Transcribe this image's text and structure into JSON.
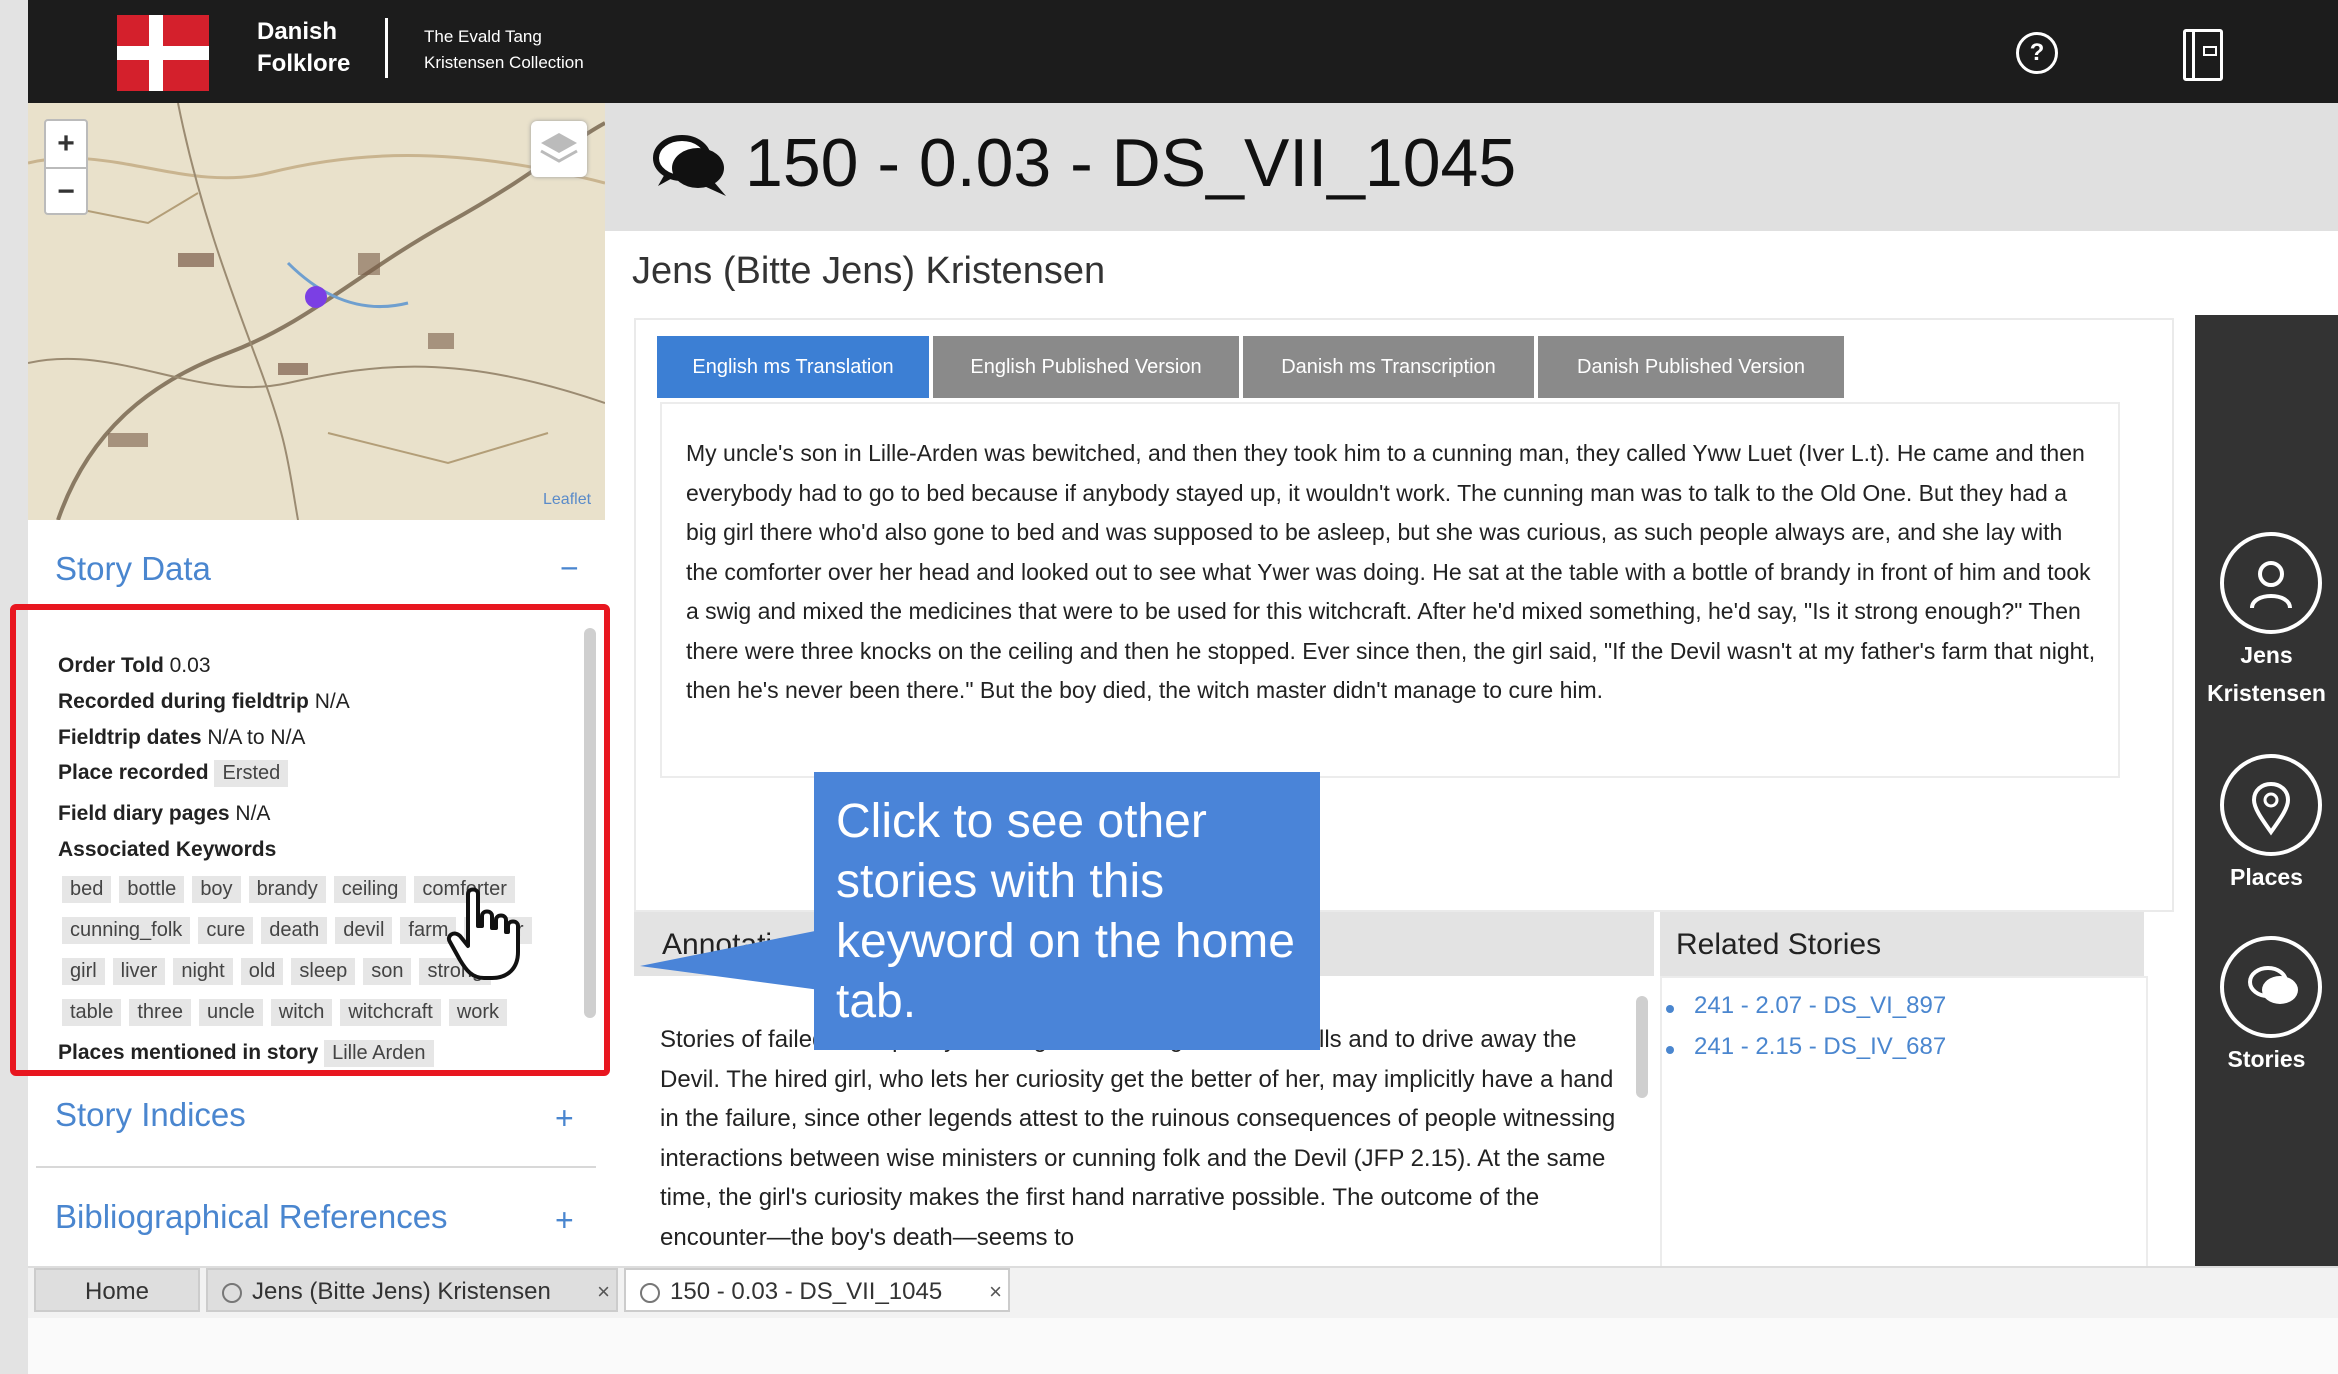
{
  "header": {
    "brand_line1": "Danish",
    "brand_line2": "Folklore",
    "subtitle_line1": "The Evald Tang",
    "subtitle_line2": "Kristensen Collection",
    "help_label": "?"
  },
  "map": {
    "zoom_in": "+",
    "zoom_out": "−",
    "attribution": "Leaflet",
    "marker_color": "#7b3fe4"
  },
  "story_data": {
    "title": "Story Data",
    "collapse_sign": "−",
    "order_told_label": "Order Told",
    "order_told_value": "0.03",
    "recorded_label": "Recorded during fieldtrip",
    "recorded_value": "N/A",
    "dates_label": "Fieldtrip dates",
    "dates_value": "N/A to N/A",
    "place_label": "Place recorded",
    "place_value": "Ersted",
    "diary_label": "Field diary pages",
    "diary_value": "N/A",
    "keywords_label": "Associated Keywords",
    "keywords_row1": [
      "bed",
      "bottle",
      "boy",
      "brandy",
      "ceiling",
      "comforter"
    ],
    "keywords_row2": [
      "cunning_folk",
      "cure",
      "death",
      "devil",
      "farm",
      "father"
    ],
    "keywords_row3": [
      "girl",
      "liver",
      "night",
      "old",
      "sleep",
      "son",
      "strong"
    ],
    "keywords_row4": [
      "table",
      "three",
      "uncle",
      "witch",
      "witchcraft",
      "work"
    ],
    "places_label": "Places mentioned in story",
    "places_value": "Lille Arden"
  },
  "story_indices": {
    "title": "Story Indices",
    "sign": "+"
  },
  "biblio": {
    "title": "Bibliographical References",
    "sign": "+"
  },
  "main": {
    "title": "150 - 0.03 - DS_VII_1045",
    "person": "Jens (Bitte Jens) Kristensen",
    "tabs": [
      "English ms Translation",
      "English Published Version",
      "Danish ms Transcription",
      "Danish Published Version"
    ],
    "story_text": "My uncle's son in Lille-Arden was bewitched, and then they took him to a cunning man, they called Yww Luet (Iver L.t). He came and then everybody had to go to bed because if anybody stayed up, it wouldn't work. The cunning man was to talk to the Old One. But they had a big girl there who'd also gone to bed and was supposed to be asleep, but she was curious, as such people always are, and she lay with the comforter over her head and looked out to see what Ywer was doing. He sat at the table with a bottle of brandy in front of him and took a swig and mixed the medicines that were to be used for this witchcraft. After he'd mixed something, he'd say, \"Is it strong enough?\" Then there were three knocks on the ceiling and then he stopped. Ever since then, the girl said, \"If the Devil wasn't at my father's farm that night, then he's never been there.\" But the boy died, the witch master didn't manage to cure him.",
    "annotation_header": "Annotation",
    "annotation_text": "Stories of failed attempts by cunning folk ... hiring folk to cure ills and to drive away the Devil. The hired girl, who lets her curiosity get the better of her, may implicitly have a hand in the failure, since other legends attest to the ruinous consequences of people witnessing interactions between wise ministers or cunning folk and the Devil (JFP 2.15). At the same time, the girl's curiosity makes the first hand narrative possible. The outcome of the encounter—the boy's death—seems to",
    "related_header": "Related Stories",
    "related": [
      "241 - 2.07 - DS_VI_897",
      "241 - 2.15 - DS_IV_687"
    ]
  },
  "right_panel": {
    "person_label_1": "Jens",
    "person_label_2": "Kristensen",
    "places_label": "Places",
    "stories_label": "Stories"
  },
  "callout": {
    "text": "Click to see other stories with this keyword on the home tab."
  },
  "bottom_tabs": {
    "home": "Home",
    "person": "Jens (Bitte Jens) Kristensen",
    "story": "150 - 0.03 - DS_VII_1045",
    "close": "×"
  },
  "colors": {
    "accent": "#4a86cf",
    "active_tab": "#3c7fd4",
    "inactive_tab": "#8a8a8a",
    "highlight": "#e8161f",
    "callout": "#4a84d8"
  }
}
